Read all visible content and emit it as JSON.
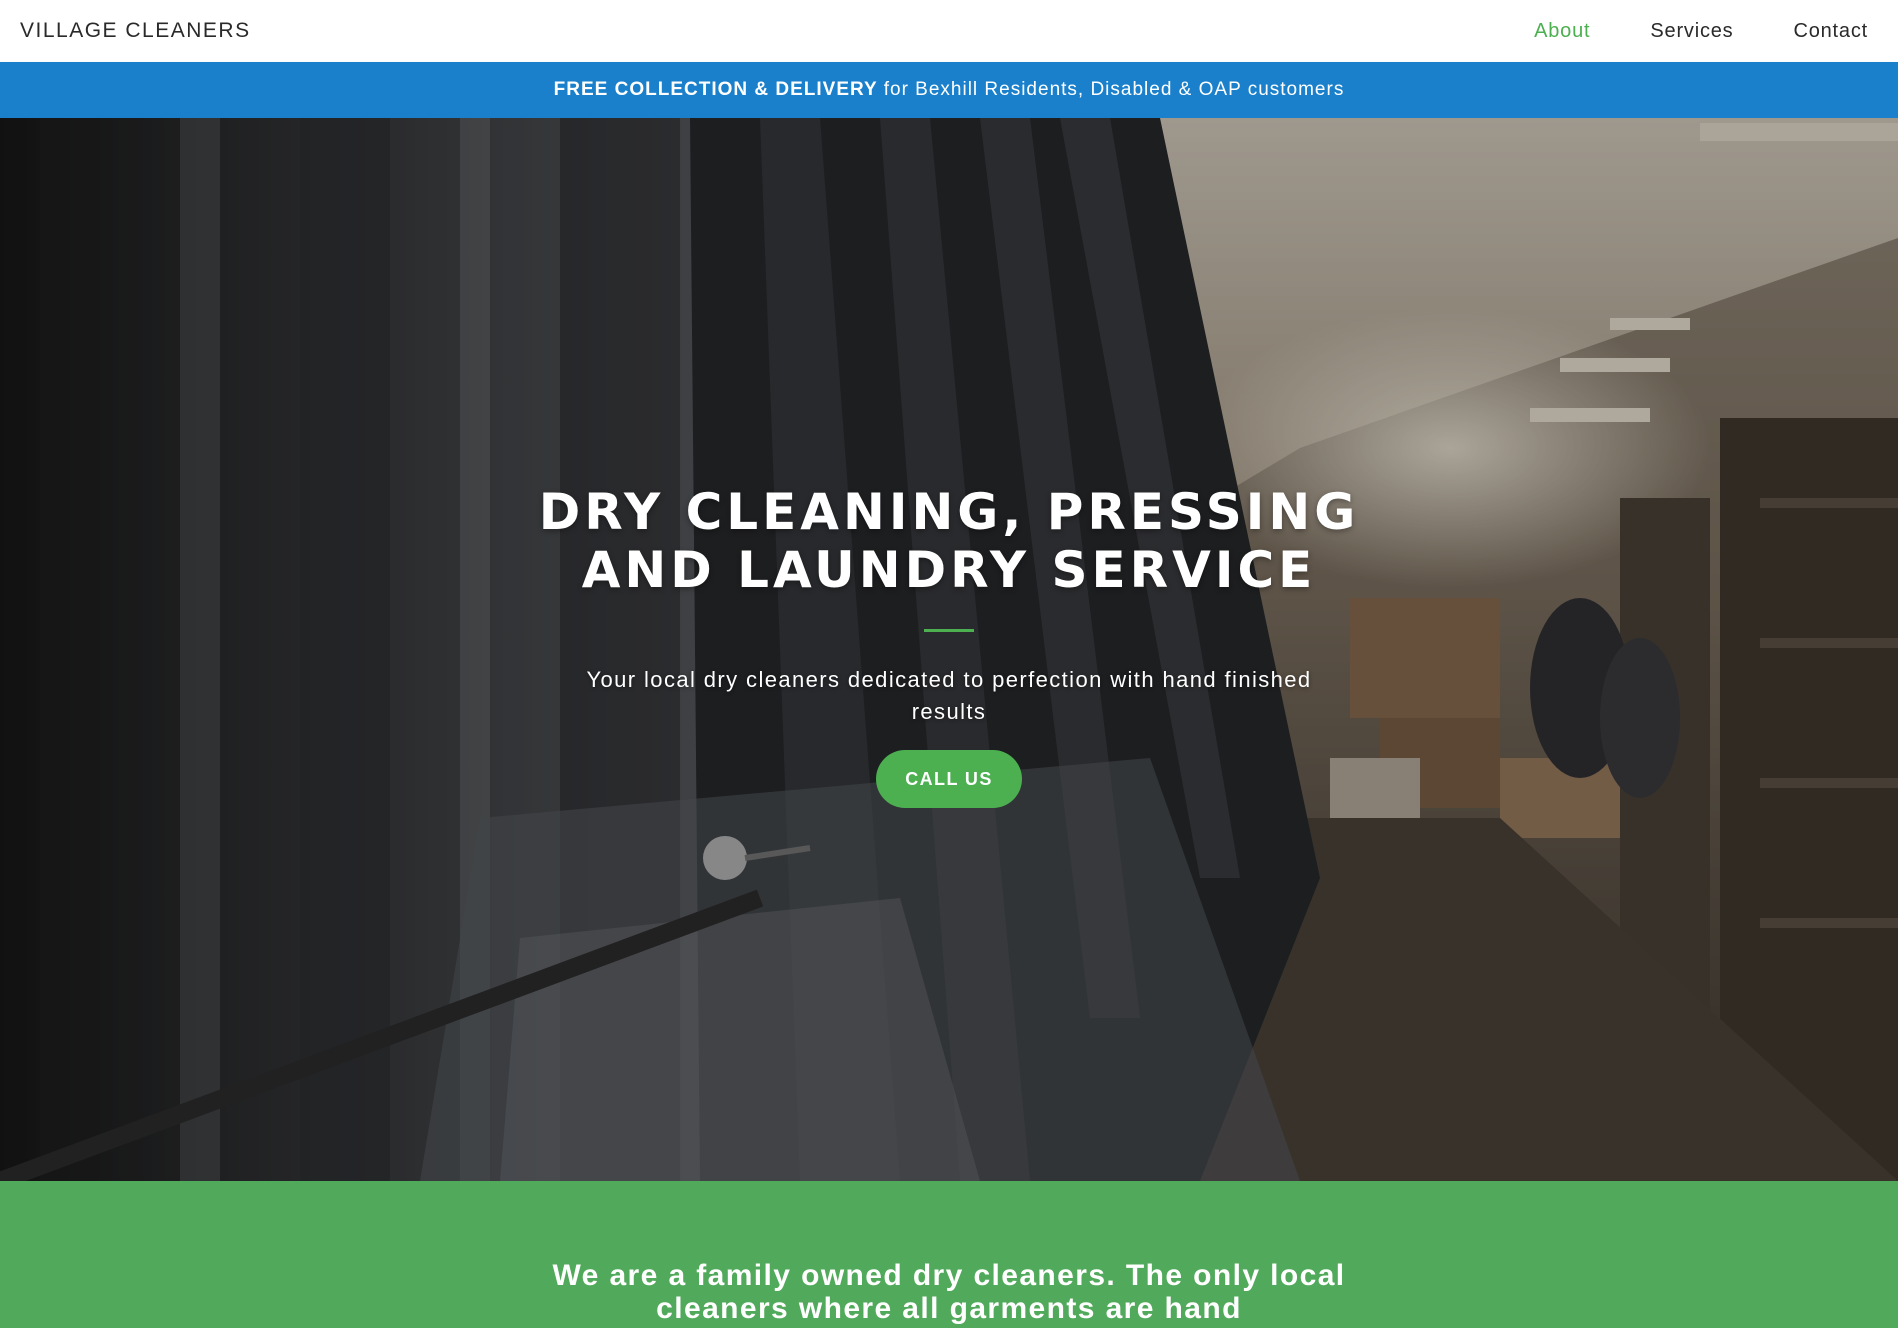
{
  "brand": {
    "name": "VILLAGE CLEANERS"
  },
  "nav": {
    "items": [
      {
        "label": "About",
        "active": true
      },
      {
        "label": "Services",
        "active": false
      },
      {
        "label": "Contact",
        "active": false
      }
    ]
  },
  "banner": {
    "strong": "FREE COLLECTION & DELIVERY",
    "text": "for Bexhill Residents, Disabled & OAP customers"
  },
  "hero": {
    "title": "DRY CLEANING, PRESSING AND LAUNDRY SERVICE",
    "subtitle": "Your local dry cleaners dedicated to perfection with hand finished results",
    "cta_label": "CALL US"
  },
  "about": {
    "text": "We are a family owned dry cleaners. The only local cleaners where all garments are hand"
  },
  "colors": {
    "accent": "#4caf50",
    "banner": "#1a80cb",
    "about_bg": "#51aa5b"
  }
}
